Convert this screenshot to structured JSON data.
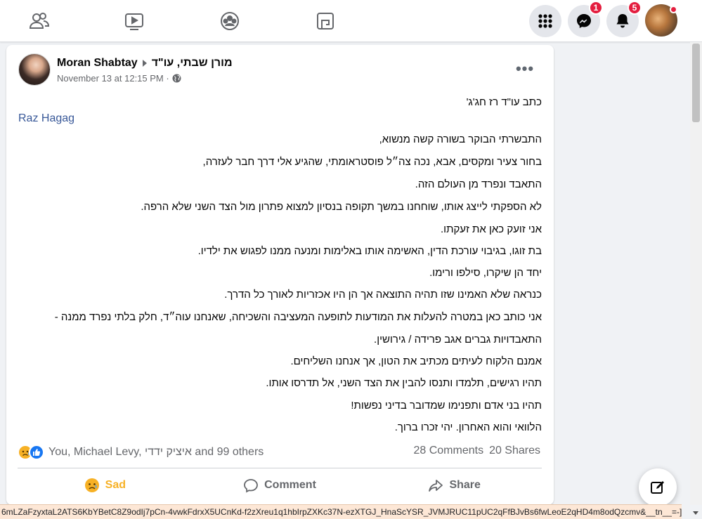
{
  "nav": {
    "badges": {
      "messenger": "1",
      "notifications": "5"
    }
  },
  "post": {
    "author": "Moran Shabtay",
    "group": "מורן שבתי, עו\"ד",
    "timestamp": "November 13 at 12:15 PM · ",
    "more": "•••",
    "mention": "Raz Hagag",
    "lines": [
      "כתב עו\"ד רז חג'ג'",
      "התבשרתי הבוקר בשורה קשה מנשוא,",
      "בחור צעיר ומקסים, אבא, נכה צה״ל פוסטראומתי, שהגיע אלי דרך חבר לעזרה,",
      "התאבד ונפרד מן העולם הזה.",
      "לא הספקתי לייצג אותו, שוחחנו במשך תקופה בנסיון למצוא פתרון מול הצד השני שלא הרפה.",
      "אני זועק כאן את זעקתו.",
      "בת זוגו, בגיבוי עורכת הדין, האשימה אותו באלימות ומנעה ממנו לפגוש את ילדיו.",
      "יחד הן שיקרו, סילפו ורימו.",
      "כנראה שלא האמינו שזו תהיה התוצאה אך הן היו אכזריות לאורך כל הדרך.",
      "אני כותב כאן במטרה להעלות את המודעות לתופעה המעציבה והשכיחה, שאנחנו עוה״ד, חלק בלתי נפרד ממנה -",
      "התאבדויות גברים אגב פרידה / גירושין.",
      "אמנם הלקוח לעיתים מכתיב את הטון, אך אנחנו השליחים.",
      "תהיו רגישים, תלמדו ותנסו להבין את הצד השני, אל תדרסו אותו.",
      "תהיו בני אדם ותפנימו שמדובר בדיני נפשות!",
      "הלוואי והוא האחרון. יהי זכרו ברוך."
    ],
    "reactions_text": "You, Michael Levy, איציק ידדי and 99 others",
    "comments_count": "28 Comments",
    "shares_count": "20 Shares",
    "actions": {
      "sad": "Sad",
      "comment": "Comment",
      "share": "Share"
    }
  },
  "colors": {
    "brand": "#1877f2",
    "sad": "#f7b125",
    "badge": "#e41e3f",
    "link": "#385898"
  },
  "status_url": "6mLZaFzyxtaL2ATS6KbYBetC8Z9odIj7pCn-4vwkFdrxX5UCnKd-f2zXreu1q1hbIrpZXKc37N-ezXTGJ_HnaScYSR_JVMJRUC11pUC2qFfBJvBs6fwLeoE2qHD4m8odQzcmv&__tn__=-]..."
}
